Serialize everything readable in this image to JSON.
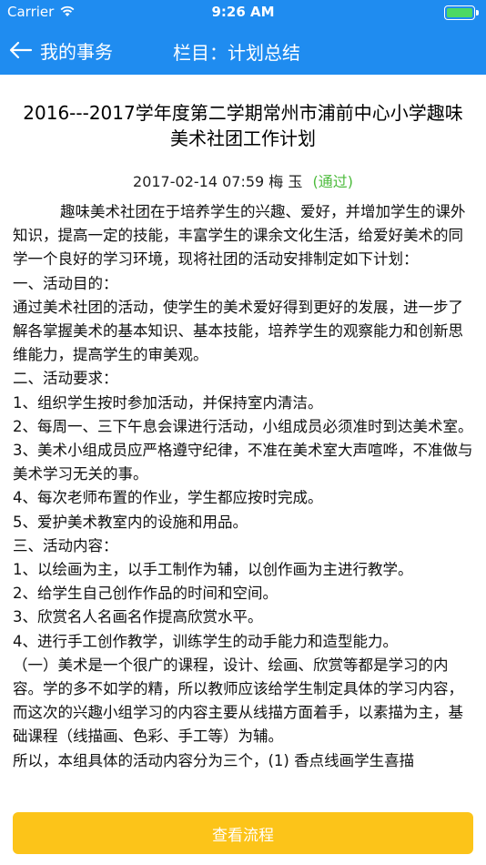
{
  "status_bar": {
    "carrier": "Carrier",
    "time": "9:26 AM",
    "battery_level": 1.0
  },
  "nav": {
    "back_label": "我的事务",
    "title": "栏目：计划总结"
  },
  "article": {
    "title": "2016---2017学年度第二学期常州市浦前中心小学趣味美术社团工作计划",
    "date": "2017-02-14 07:59",
    "author": "梅 玉",
    "status": "(通过)",
    "paragraphs": [
      "趣味美术社团在于培养学生的兴趣、爱好，并增加学生的课外知识，提高一定的技能，丰富学生的课余文化生活，给爱好美术的同学一个良好的学习环境，现将社团的活动安排制定如下计划：",
      "一、活动目的：",
      "通过美术社团的活动，使学生的美术爱好得到更好的发展，进一步了解各掌握美术的基本知识、基本技能，培养学生的观察能力和创新思维能力，提高学生的审美观。",
      "二、活动要求：",
      "1、组织学生按时参加活动，并保持室内清洁。",
      "2、每周一、三下午息会课进行活动，小组成员必须准时到达美术室。",
      "3、美术小组成员应严格遵守纪律，不准在美术室大声喧哗，不准做与美术学习无关的事。",
      "4、每次老师布置的作业，学生都应按时完成。",
      "5、爱护美术教室内的设施和用品。",
      "三、活动内容：",
      "1、以绘画为主，以手工制作为辅，以创作画为主进行教学。",
      "2、给学生自己创作作品的时间和空间。",
      "3、欣赏名人名画名作提高欣赏水平。",
      "4、进行手工创作教学，训练学生的动手能力和造型能力。",
      "（一）美术是一个很广的课程，设计、绘画、欣赏等都是学习的内容。学的多不如学的精，所以教师应该给学生制定具体的学习内容，而这次的兴趣小组学习的内容主要从线描方面着手，以素描为主，基础课程（线描画、色彩、手工等）为辅。",
      "所以，本组具体的活动内容分为三个，(1) 香点线画学生喜描"
    ]
  },
  "footer": {
    "button_label": "查看流程"
  },
  "colors": {
    "primary": "#1f8cf0",
    "status_ok": "#4cbb3c",
    "button": "#fcc419"
  }
}
